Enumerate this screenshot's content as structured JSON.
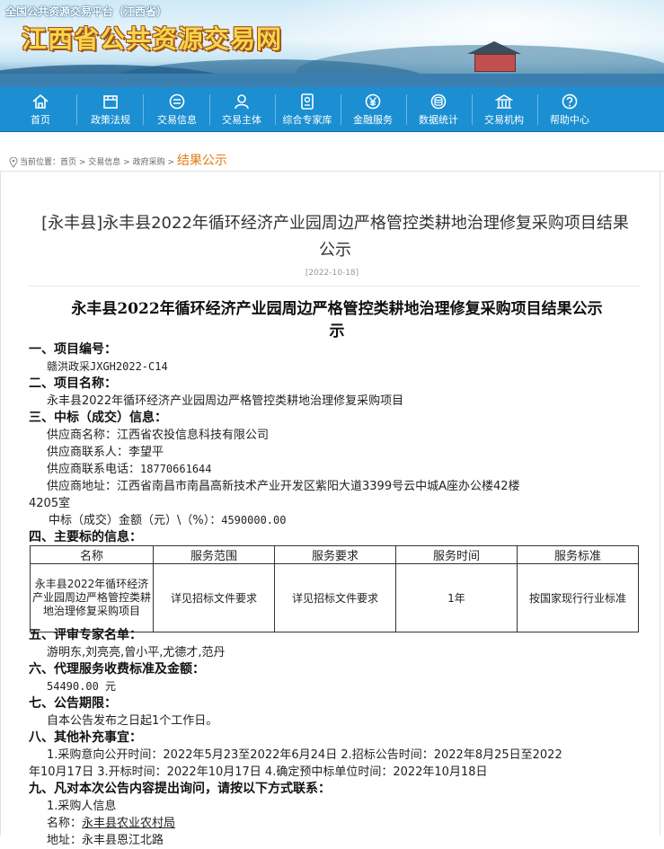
{
  "header": {
    "platform": "全国公共资源交易平台（江西省）",
    "site_name": "江西省公共资源交易网"
  },
  "nav": [
    {
      "label": "首页",
      "icon": "home-icon"
    },
    {
      "label": "政策法规",
      "icon": "folder-icon"
    },
    {
      "label": "交易信息",
      "icon": "list-icon"
    },
    {
      "label": "交易主体",
      "icon": "user-icon"
    },
    {
      "label": "综合专家库",
      "icon": "id-card-icon"
    },
    {
      "label": "金融服务",
      "icon": "yen-icon"
    },
    {
      "label": "数据统计",
      "icon": "database-icon"
    },
    {
      "label": "交易机构",
      "icon": "building-icon"
    },
    {
      "label": "帮助中心",
      "icon": "help-icon"
    }
  ],
  "breadcrumb": {
    "prefix": "当前位置：",
    "items": [
      "首页",
      "交易信息",
      "政府采购"
    ],
    "sep": " > ",
    "current": "结果公示"
  },
  "article": {
    "title_line1": "[永丰县]永丰县2022年循环经济产业园周边严格管控类耕地治理修复采购项目结果",
    "title_line2": "公示",
    "date": "[2022-10-18]"
  },
  "doc": {
    "title_line1": "永丰县2022年循环经济产业园周边严格管控类耕地治理修复采购项目结果公示",
    "title_line2": "示",
    "s1": "一、项目编号：",
    "project_no": "赣洪政采JXGH2022-C14",
    "s2": "二、项目名称：",
    "project_name": "永丰县2022年循环经济产业园周边严格管控类耕地治理修复采购项目",
    "s3": "三、中标（成交）信息：",
    "supplier_name": "供应商名称：江西省农投信息科技有限公司",
    "supplier_contact": "供应商联系人：李望平",
    "supplier_phone_label": "供应商联系电话：",
    "supplier_phone": "18770661644",
    "supplier_addr_line1": "供应商地址：江西省南昌市南昌高新技术产业开发区紫阳大道3399号云中城A座办公楼42楼",
    "supplier_addr_line2": "4205室",
    "amount_label": "中标（成交）金额（元）\\（%）：",
    "amount": "4590000.00",
    "s4": "四、主要标的信息：",
    "table_headers": [
      "名称",
      "服务范围",
      "服务要求",
      "服务时间",
      "服务标准"
    ],
    "table_row": [
      "永丰县2022年循环经济产业园周边严格管控类耕地治理修复采购项目",
      "详见招标文件要求",
      "详见招标文件要求",
      "1年",
      "按国家现行行业标准"
    ],
    "s5": "五、评审专家名单：",
    "experts": "游明东,刘亮亮,曾小平,尤德才,范丹",
    "s6": "六、代理服务收费标准及金额：",
    "fee": "54490.00 元",
    "s7": "七、公告期限：",
    "period": "自本公告发布之日起1个工作日。",
    "s8": "八、其他补充事宜：",
    "other_line1": "1.采购意向公开时间：2022年5月23至2022年6月24日 2.招标公告时间：2022年8月25日至2022",
    "other_line2": "年10月17日 3.开标时间：2022年10月17日 4.确定预中标单位时间：2022年10月18日",
    "s9": "九、凡对本次公告内容提出询问，请按以下方式联系：",
    "buyer_heading": "1.采购人信息",
    "buyer_name_label": "名称：",
    "buyer_name": "永丰县农业农村局",
    "buyer_addr_partial": "地址：永丰县恩江北路"
  },
  "colors": {
    "nav_bg": "#1b8fd2",
    "site_name": "#f7d64a",
    "breadcrumb_current": "#e07a10"
  }
}
